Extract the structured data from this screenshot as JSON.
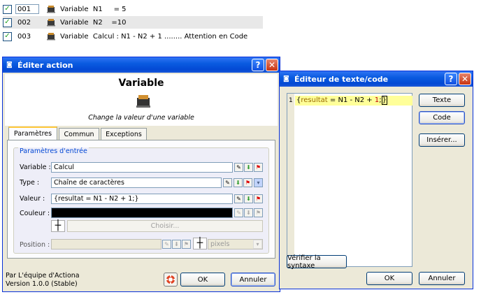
{
  "actions": [
    {
      "number": "001",
      "text": "Variable  N1     = 5",
      "selected": false
    },
    {
      "number": "002",
      "text": "Variable  N2    =10",
      "selected": true
    },
    {
      "number": "003",
      "text": "Variable  Calcul : N1 - N2 + 1 ........ Attention en Code",
      "selected": false
    }
  ],
  "edit_window": {
    "title": "Éditer action",
    "heading": "Variable",
    "subtitle": "Change la valeur d'une variable",
    "tabs": [
      "Paramètres",
      "Commun",
      "Exceptions"
    ],
    "group_title": "Paramètres d'entrée",
    "fields": {
      "variable_label": "Variable :",
      "variable_value": "Calcul",
      "type_label": "Type :",
      "type_value": "Chaîne de caractères",
      "valeur_label": "Valeur :",
      "valeur_value": "{resultat = N1 - N2 + 1;}",
      "couleur_label": "Couleur :",
      "choisir_label": "Choisir...",
      "position_label": "Position :",
      "units_value": "pixels"
    },
    "footer_line1": "Par L'équipe d'Actiona",
    "footer_line2": "Version 1.0.0 (Stable)",
    "ok_label": "OK",
    "cancel_label": "Annuler"
  },
  "text_window": {
    "title": "Éditeur de texte/code",
    "line_number": "1",
    "code_parts": {
      "brace_open": "{",
      "ident": "resultat",
      "op_eq": " = ",
      "n1": "N1",
      "op_minus": " - ",
      "n2": "N2",
      "op_plus": " + ",
      "one": "1",
      "semi": ";",
      "brace_close": "}"
    },
    "texte_button": "Texte",
    "code_button": "Code",
    "inserer_button": "Insérer...",
    "verify_button": "Vérifier la syntaxe",
    "ok_label": "OK",
    "cancel_label": "Annuler"
  },
  "colors": {
    "titlebar": "#0a5be0",
    "highlight_line": "#ffff99",
    "code_keyword": "#9a6a00",
    "code_number": "#c00000"
  }
}
